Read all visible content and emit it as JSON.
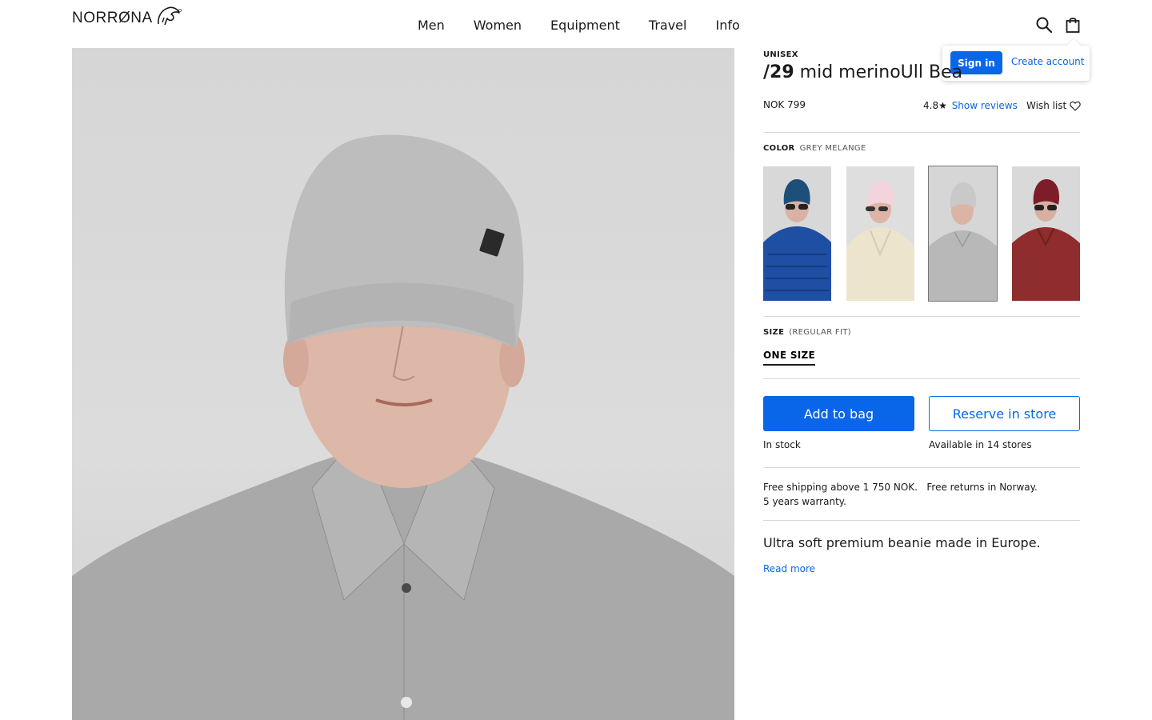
{
  "header": {
    "logo_text": "NORRØNA",
    "nav": [
      "Men",
      "Women",
      "Equipment",
      "Travel",
      "Info"
    ],
    "search_icon": "search-icon",
    "bag_icon": "shopping-bag-icon"
  },
  "account_popover": {
    "sign_in": "Sign in",
    "create_account": "Create account"
  },
  "product": {
    "category": "UNISEX",
    "title_bold": "/29",
    "title_rest": " mid merinoUll Bea",
    "price": "NOK 799",
    "rating": "4.8",
    "rating_star": "★",
    "show_reviews": "Show reviews",
    "wish_list": "Wish list",
    "color_label": "COLOR",
    "color_value": "GREY MELANGE",
    "swatches": [
      {
        "name": "Blue",
        "hat": "#1d4f7a",
        "jacket": "#1f4fa3",
        "selected": false
      },
      {
        "name": "Pink",
        "hat": "#f3d3dc",
        "jacket": "#ece4cd",
        "selected": false
      },
      {
        "name": "Grey Melange",
        "hat": "#c9c9c9",
        "jacket": "#bdbdbd",
        "selected": true
      },
      {
        "name": "Red",
        "hat": "#7d1d2a",
        "jacket": "#8f2c2d",
        "selected": false
      }
    ],
    "size_label": "SIZE",
    "size_fit": "(REGULAR FIT)",
    "size_option": "ONE SIZE",
    "add_to_bag": "Add to bag",
    "reserve_in_store": "Reserve in store",
    "in_stock": "In stock",
    "available_stores": "Available in 14 stores",
    "shipping_line1": "Free shipping above 1 750 NOK.   Free returns in Norway.",
    "shipping_line2": "5 years warranty.",
    "description": "Ultra soft premium beanie made in Europe.",
    "read_more": "Read more"
  },
  "colors": {
    "accent": "#0a66e8",
    "text": "#1a1a1a",
    "divider": "#d8d8d8"
  }
}
